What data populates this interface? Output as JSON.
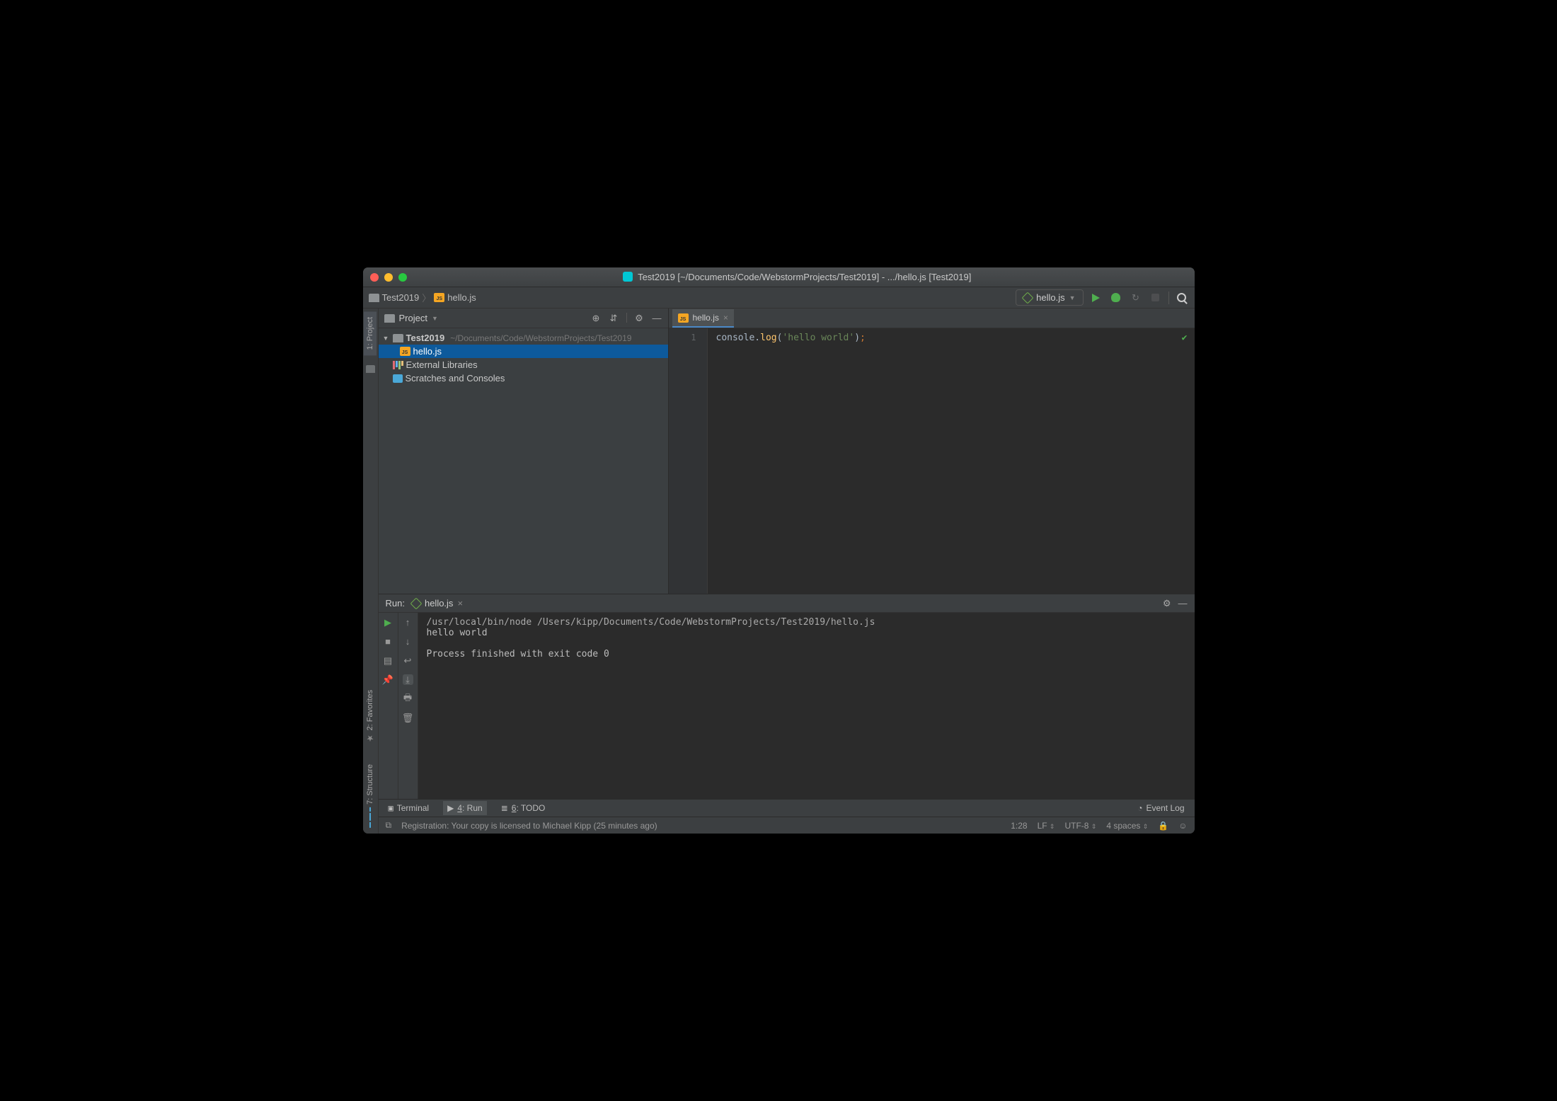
{
  "window": {
    "title": "Test2019 [~/Documents/Code/WebstormProjects/Test2019] - .../hello.js [Test2019]"
  },
  "breadcrumbs": {
    "project": "Test2019",
    "file": "hello.js"
  },
  "runConfig": {
    "name": "hello.js"
  },
  "sidebar": {
    "project": "1: Project",
    "favorites": "2: Favorites",
    "structure": "7: Structure"
  },
  "projectPane": {
    "title": "Project",
    "root": {
      "name": "Test2019",
      "path": "~/Documents/Code/WebstormProjects/Test2019"
    },
    "file": "hello.js",
    "external": "External Libraries",
    "scratches": "Scratches and Consoles"
  },
  "editor": {
    "tab": "hello.js",
    "lineNum": "1",
    "code": {
      "obj": "console",
      "dot": ".",
      "fn": "log",
      "open": "(",
      "str": "'hello world'",
      "close": ")",
      "semi": ";"
    }
  },
  "run": {
    "label": "Run:",
    "tab": "hello.js",
    "output": {
      "cmd": "/usr/local/bin/node /Users/kipp/Documents/Code/WebstormProjects/Test2019/hello.js",
      "line1": "hello world",
      "line2": "",
      "line3": "Process finished with exit code 0"
    }
  },
  "bottomBar": {
    "terminal": "Terminal",
    "run": "4: Run",
    "todo": "6: TODO",
    "eventLog": "Event Log"
  },
  "status": {
    "registration": "Registration: Your copy is licensed to Michael Kipp (25 minutes ago)",
    "cursor": "1:28",
    "le": "LF",
    "enc": "UTF-8",
    "indent": "4 spaces"
  }
}
